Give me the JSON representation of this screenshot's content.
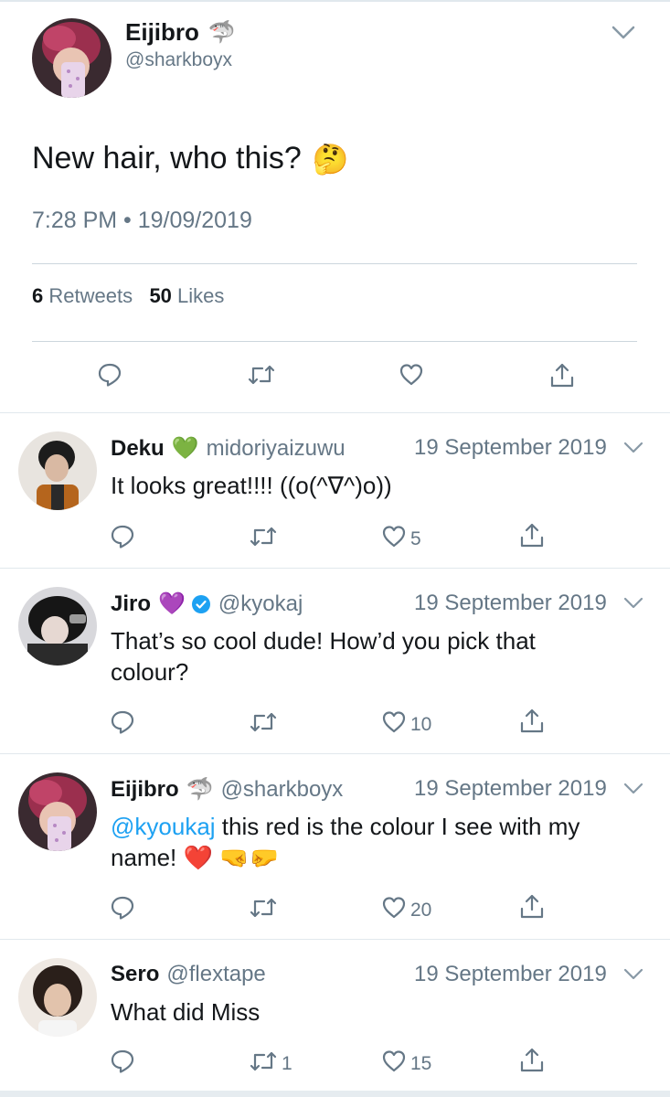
{
  "main_tweet": {
    "display_name": "Eijibro",
    "name_emoji": "🦈",
    "handle": "@sharkboyx",
    "text": "New hair, who this?",
    "text_emoji": "🤔",
    "timestamp": "7:28 PM • 19/09/2019",
    "retweet_count": "6",
    "retweet_label": "Retweets",
    "like_count": "50",
    "like_label": "Likes",
    "actions": [
      "reply-icon",
      "retweet-icon",
      "like-icon",
      "share-icon"
    ]
  },
  "replies": [
    {
      "name": "Deku",
      "emoji": "💚",
      "verified": false,
      "handle": "midoriyaizuwu",
      "date": "19 September 2019",
      "mention": "",
      "text": "It looks great!!!! ((o(^∇^)o))",
      "retweets": "",
      "likes": "5"
    },
    {
      "name": "Jiro",
      "emoji": "💜",
      "verified": true,
      "handle": "@kyokaj",
      "date": "19 September 2019",
      "mention": "",
      "text": "That’s so cool dude! How’d you pick that colour?",
      "retweets": "",
      "likes": "10"
    },
    {
      "name": "Eijibro",
      "emoji": "🦈",
      "verified": false,
      "handle": "@sharkboyx",
      "date": "19 September 2019",
      "mention": "@kyoukaj",
      "text": " this red is the colour I see with my name! ❤️ 🤜🤛",
      "retweets": "",
      "likes": "20"
    },
    {
      "name": "Sero",
      "emoji": "",
      "verified": false,
      "handle": "@flextape",
      "date": "19 September 2019",
      "mention": "",
      "text": "What did Miss",
      "retweets": "1",
      "likes": "15"
    }
  ],
  "colors": {
    "text": "#14171a",
    "secondary": "#657786",
    "link": "#1da1f2",
    "verified": "#1da1f2",
    "divider": "#e1e8ed"
  }
}
